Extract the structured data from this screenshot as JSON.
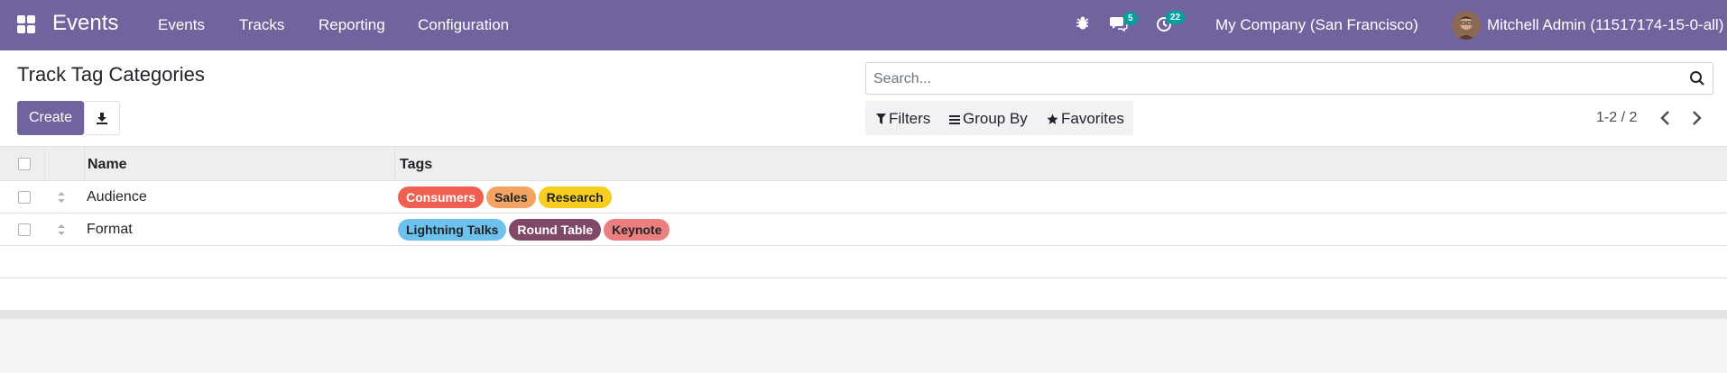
{
  "navbar": {
    "app_name": "Events",
    "menu": [
      "Events",
      "Tracks",
      "Reporting",
      "Configuration"
    ],
    "messages_count": "5",
    "activities_count": "22",
    "company": "My Company (San Francisco)",
    "user": "Mitchell Admin (11517174-15-0-all)"
  },
  "control_panel": {
    "title": "Track Tag Categories",
    "create_label": "Create",
    "search_placeholder": "Search...",
    "filters_label": "Filters",
    "group_by_label": "Group By",
    "favorites_label": "Favorites",
    "pager": "1-2 / 2"
  },
  "table": {
    "columns": [
      "Name",
      "Tags"
    ],
    "rows": [
      {
        "name": "Audience",
        "tags": [
          {
            "label": "Consumers",
            "color": "#f06050"
          },
          {
            "label": "Sales",
            "color": "#f4a460"
          },
          {
            "label": "Research",
            "color": "#f7cd1f"
          }
        ]
      },
      {
        "name": "Format",
        "tags": [
          {
            "label": "Lightning Talks",
            "color": "#6cc1ed"
          },
          {
            "label": "Round Table",
            "color": "#814968"
          },
          {
            "label": "Keynote",
            "color": "#eb7e7f"
          }
        ]
      }
    ]
  },
  "colors": {
    "brand": "#71639e",
    "badge": "#00a09d"
  }
}
